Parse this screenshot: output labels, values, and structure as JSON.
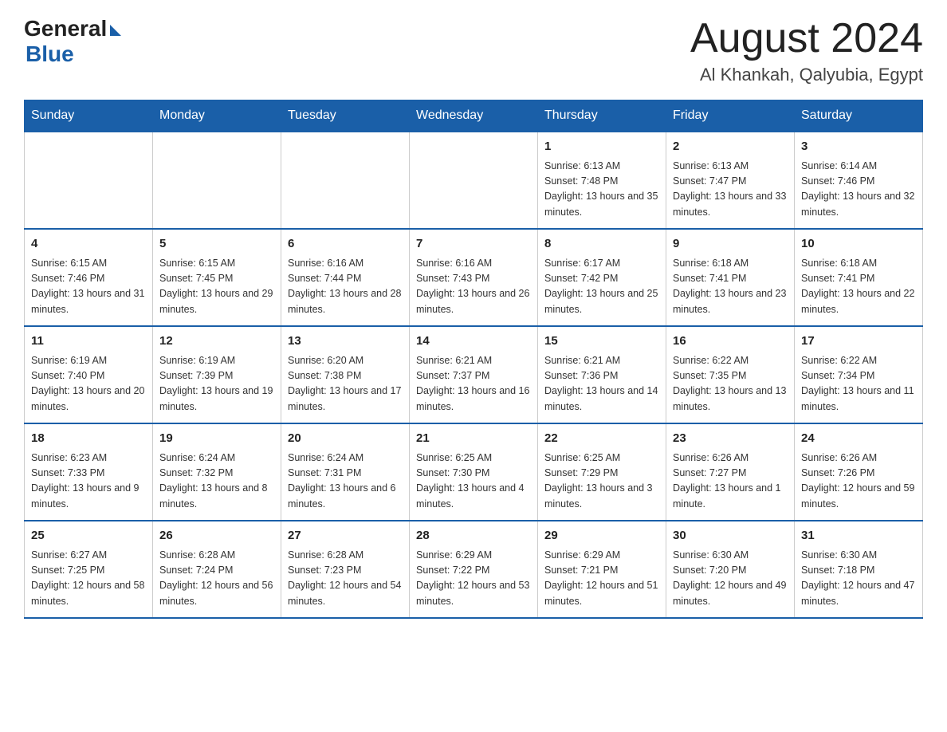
{
  "header": {
    "logo_general": "General",
    "logo_blue": "Blue",
    "month_year": "August 2024",
    "location": "Al Khankah, Qalyubia, Egypt"
  },
  "weekdays": [
    "Sunday",
    "Monday",
    "Tuesday",
    "Wednesday",
    "Thursday",
    "Friday",
    "Saturday"
  ],
  "weeks": [
    [
      {
        "day": "",
        "info": ""
      },
      {
        "day": "",
        "info": ""
      },
      {
        "day": "",
        "info": ""
      },
      {
        "day": "",
        "info": ""
      },
      {
        "day": "1",
        "info": "Sunrise: 6:13 AM\nSunset: 7:48 PM\nDaylight: 13 hours and 35 minutes."
      },
      {
        "day": "2",
        "info": "Sunrise: 6:13 AM\nSunset: 7:47 PM\nDaylight: 13 hours and 33 minutes."
      },
      {
        "day": "3",
        "info": "Sunrise: 6:14 AM\nSunset: 7:46 PM\nDaylight: 13 hours and 32 minutes."
      }
    ],
    [
      {
        "day": "4",
        "info": "Sunrise: 6:15 AM\nSunset: 7:46 PM\nDaylight: 13 hours and 31 minutes."
      },
      {
        "day": "5",
        "info": "Sunrise: 6:15 AM\nSunset: 7:45 PM\nDaylight: 13 hours and 29 minutes."
      },
      {
        "day": "6",
        "info": "Sunrise: 6:16 AM\nSunset: 7:44 PM\nDaylight: 13 hours and 28 minutes."
      },
      {
        "day": "7",
        "info": "Sunrise: 6:16 AM\nSunset: 7:43 PM\nDaylight: 13 hours and 26 minutes."
      },
      {
        "day": "8",
        "info": "Sunrise: 6:17 AM\nSunset: 7:42 PM\nDaylight: 13 hours and 25 minutes."
      },
      {
        "day": "9",
        "info": "Sunrise: 6:18 AM\nSunset: 7:41 PM\nDaylight: 13 hours and 23 minutes."
      },
      {
        "day": "10",
        "info": "Sunrise: 6:18 AM\nSunset: 7:41 PM\nDaylight: 13 hours and 22 minutes."
      }
    ],
    [
      {
        "day": "11",
        "info": "Sunrise: 6:19 AM\nSunset: 7:40 PM\nDaylight: 13 hours and 20 minutes."
      },
      {
        "day": "12",
        "info": "Sunrise: 6:19 AM\nSunset: 7:39 PM\nDaylight: 13 hours and 19 minutes."
      },
      {
        "day": "13",
        "info": "Sunrise: 6:20 AM\nSunset: 7:38 PM\nDaylight: 13 hours and 17 minutes."
      },
      {
        "day": "14",
        "info": "Sunrise: 6:21 AM\nSunset: 7:37 PM\nDaylight: 13 hours and 16 minutes."
      },
      {
        "day": "15",
        "info": "Sunrise: 6:21 AM\nSunset: 7:36 PM\nDaylight: 13 hours and 14 minutes."
      },
      {
        "day": "16",
        "info": "Sunrise: 6:22 AM\nSunset: 7:35 PM\nDaylight: 13 hours and 13 minutes."
      },
      {
        "day": "17",
        "info": "Sunrise: 6:22 AM\nSunset: 7:34 PM\nDaylight: 13 hours and 11 minutes."
      }
    ],
    [
      {
        "day": "18",
        "info": "Sunrise: 6:23 AM\nSunset: 7:33 PM\nDaylight: 13 hours and 9 minutes."
      },
      {
        "day": "19",
        "info": "Sunrise: 6:24 AM\nSunset: 7:32 PM\nDaylight: 13 hours and 8 minutes."
      },
      {
        "day": "20",
        "info": "Sunrise: 6:24 AM\nSunset: 7:31 PM\nDaylight: 13 hours and 6 minutes."
      },
      {
        "day": "21",
        "info": "Sunrise: 6:25 AM\nSunset: 7:30 PM\nDaylight: 13 hours and 4 minutes."
      },
      {
        "day": "22",
        "info": "Sunrise: 6:25 AM\nSunset: 7:29 PM\nDaylight: 13 hours and 3 minutes."
      },
      {
        "day": "23",
        "info": "Sunrise: 6:26 AM\nSunset: 7:27 PM\nDaylight: 13 hours and 1 minute."
      },
      {
        "day": "24",
        "info": "Sunrise: 6:26 AM\nSunset: 7:26 PM\nDaylight: 12 hours and 59 minutes."
      }
    ],
    [
      {
        "day": "25",
        "info": "Sunrise: 6:27 AM\nSunset: 7:25 PM\nDaylight: 12 hours and 58 minutes."
      },
      {
        "day": "26",
        "info": "Sunrise: 6:28 AM\nSunset: 7:24 PM\nDaylight: 12 hours and 56 minutes."
      },
      {
        "day": "27",
        "info": "Sunrise: 6:28 AM\nSunset: 7:23 PM\nDaylight: 12 hours and 54 minutes."
      },
      {
        "day": "28",
        "info": "Sunrise: 6:29 AM\nSunset: 7:22 PM\nDaylight: 12 hours and 53 minutes."
      },
      {
        "day": "29",
        "info": "Sunrise: 6:29 AM\nSunset: 7:21 PM\nDaylight: 12 hours and 51 minutes."
      },
      {
        "day": "30",
        "info": "Sunrise: 6:30 AM\nSunset: 7:20 PM\nDaylight: 12 hours and 49 minutes."
      },
      {
        "day": "31",
        "info": "Sunrise: 6:30 AM\nSunset: 7:18 PM\nDaylight: 12 hours and 47 minutes."
      }
    ]
  ]
}
